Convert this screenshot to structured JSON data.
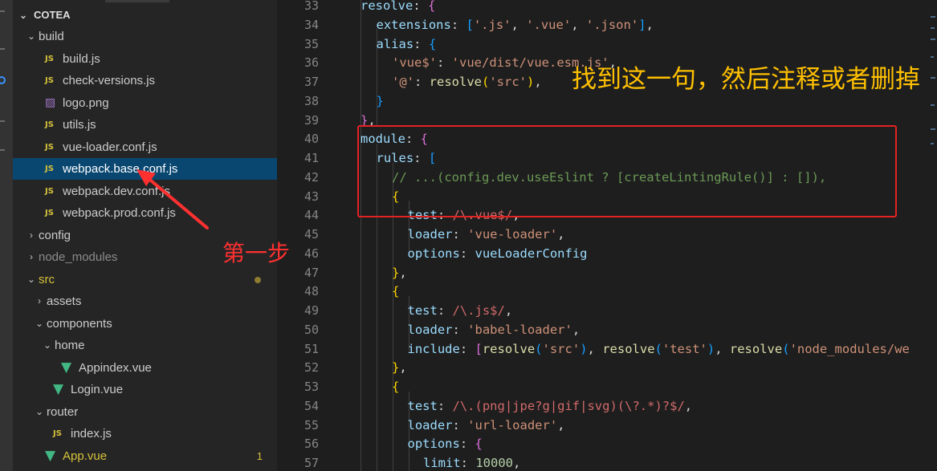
{
  "explorer": {
    "root": "COTEA",
    "items": [
      {
        "label": "build",
        "kind": "folder",
        "state": "expanded",
        "depth": 1
      },
      {
        "label": "build.js",
        "kind": "js",
        "depth": 2
      },
      {
        "label": "check-versions.js",
        "kind": "js",
        "depth": 2
      },
      {
        "label": "logo.png",
        "kind": "png",
        "depth": 2
      },
      {
        "label": "utils.js",
        "kind": "js",
        "depth": 2
      },
      {
        "label": "vue-loader.conf.js",
        "kind": "js",
        "depth": 2
      },
      {
        "label": "webpack.base.conf.js",
        "kind": "js",
        "depth": 2,
        "selected": true
      },
      {
        "label": "webpack.dev.conf.js",
        "kind": "js",
        "depth": 2
      },
      {
        "label": "webpack.prod.conf.js",
        "kind": "js",
        "depth": 2
      },
      {
        "label": "config",
        "kind": "folder",
        "state": "collapsed",
        "depth": 1
      },
      {
        "label": "node_modules",
        "kind": "folder",
        "state": "collapsed",
        "depth": 1,
        "dim": true
      },
      {
        "label": "src",
        "kind": "folder",
        "state": "expanded",
        "depth": 1,
        "modified": true,
        "dot": true
      },
      {
        "label": "assets",
        "kind": "folder",
        "state": "collapsed",
        "depth": 2
      },
      {
        "label": "components",
        "kind": "folder",
        "state": "expanded",
        "depth": 2
      },
      {
        "label": "home",
        "kind": "folder",
        "state": "expanded",
        "depth": 3
      },
      {
        "label": "Appindex.vue",
        "kind": "vue",
        "depth": 4
      },
      {
        "label": "Login.vue",
        "kind": "vue",
        "depth": 3
      },
      {
        "label": "router",
        "kind": "folder",
        "state": "expanded",
        "depth": 2
      },
      {
        "label": "index.js",
        "kind": "js",
        "depth": 3
      },
      {
        "label": "App.vue",
        "kind": "vue",
        "depth": 2,
        "modified": true,
        "badge": "1"
      }
    ]
  },
  "editor": {
    "lines": [
      {
        "n": "33",
        "indent": 0,
        "html": "<span class='k'>resolve</span>: <span class='b2'>{</span>"
      },
      {
        "n": "34",
        "indent": 1,
        "html": "<span class='k'>extensions</span>: <span class='b3'>[</span><span class='s'>'.js'</span>, <span class='s'>'.vue'</span>, <span class='s'>'.json'</span><span class='b3'>]</span>,"
      },
      {
        "n": "35",
        "indent": 1,
        "html": "<span class='k'>alias</span>: <span class='b3'>{</span>"
      },
      {
        "n": "36",
        "indent": 2,
        "html": "<span class='s'>'vue$'</span>: <span class='s'>'vue/dist/vue.esm.js'</span>,"
      },
      {
        "n": "37",
        "indent": 2,
        "html": "<span class='s'>'@'</span>: <span class='f'>resolve</span><span class='b1'>(</span><span class='s'>'src'</span><span class='b1'>)</span>,"
      },
      {
        "n": "38",
        "indent": 1,
        "html": "<span class='b3'>}</span>"
      },
      {
        "n": "39",
        "indent": 0,
        "html": "<span class='b2'>}</span>,"
      },
      {
        "n": "40",
        "indent": 0,
        "html": "<span class='k'>module</span>: <span class='b2'>{</span>"
      },
      {
        "n": "41",
        "indent": 1,
        "html": "<span class='k'>rules</span>: <span class='b3'>[</span>"
      },
      {
        "n": "42",
        "indent": 2,
        "html": "<span class='c'>// ...(config.dev.useEslint ? [createLintingRule()] : []),</span>"
      },
      {
        "n": "43",
        "indent": 2,
        "html": "<span class='b1'>{</span>"
      },
      {
        "n": "44",
        "indent": 3,
        "html": "<span class='k'>test</span>: <span class='re'>/\\.vue$/</span>,"
      },
      {
        "n": "45",
        "indent": 3,
        "html": "<span class='k'>loader</span>: <span class='s'>'vue-loader'</span>,"
      },
      {
        "n": "46",
        "indent": 3,
        "html": "<span class='k'>options</span>: <span class='v'>vueLoaderConfig</span>"
      },
      {
        "n": "47",
        "indent": 2,
        "html": "<span class='b1'>}</span>,"
      },
      {
        "n": "48",
        "indent": 2,
        "html": "<span class='b1'>{</span>"
      },
      {
        "n": "49",
        "indent": 3,
        "html": "<span class='k'>test</span>: <span class='re'>/\\.js$/</span>,"
      },
      {
        "n": "50",
        "indent": 3,
        "html": "<span class='k'>loader</span>: <span class='s'>'babel-loader'</span>,"
      },
      {
        "n": "51",
        "indent": 3,
        "html": "<span class='k'>include</span>: <span class='b2'>[</span><span class='f'>resolve</span><span class='b3'>(</span><span class='s'>'src'</span><span class='b3'>)</span>, <span class='f'>resolve</span><span class='b3'>(</span><span class='s'>'test'</span><span class='b3'>)</span>, <span class='f'>resolve</span><span class='b3'>(</span><span class='s'>'node_modules/we</span>"
      },
      {
        "n": "52",
        "indent": 2,
        "html": "<span class='b1'>}</span>,"
      },
      {
        "n": "53",
        "indent": 2,
        "html": "<span class='b1'>{</span>"
      },
      {
        "n": "54",
        "indent": 3,
        "html": "<span class='k'>test</span>: <span class='re'>/\\.(png|jpe?g|gif|svg)(\\?.*)?$/</span>,"
      },
      {
        "n": "55",
        "indent": 3,
        "html": "<span class='k'>loader</span>: <span class='s'>'url-loader'</span>,"
      },
      {
        "n": "56",
        "indent": 3,
        "html": "<span class='k'>options</span>: <span class='b2'>{</span>"
      },
      {
        "n": "57",
        "indent": 4,
        "html": "<span class='k'>limit</span>: <span class='n'>10000</span>,"
      }
    ]
  },
  "annotations": {
    "main": "找到这一句，然后注释或者删掉",
    "step": "第一步"
  },
  "colors": {
    "annotation_main": "#ffc000",
    "annotation_step": "#ff3030",
    "highlight_border": "#e32222",
    "selection": "#094771"
  }
}
